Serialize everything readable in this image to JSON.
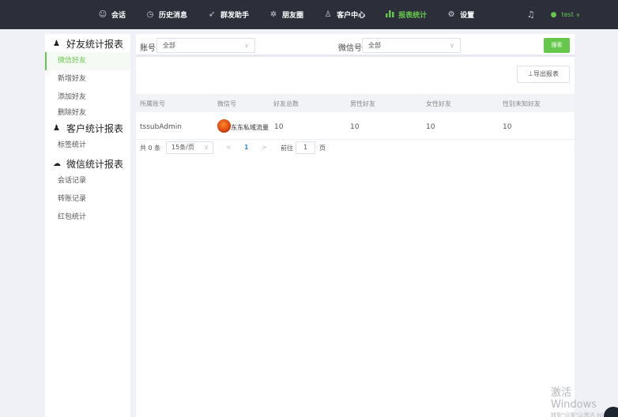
{
  "nav": {
    "items": [
      {
        "label": "会话",
        "icon": "chat-icon"
      },
      {
        "label": "历史消息",
        "icon": "clock-icon"
      },
      {
        "label": "群发助手",
        "icon": "send-icon"
      },
      {
        "label": "朋友圈",
        "icon": "aperture-icon"
      },
      {
        "label": "客户中心",
        "icon": "person-icon"
      },
      {
        "label": "报表统计",
        "icon": "bar-chart-icon",
        "active": true
      },
      {
        "label": "设置",
        "icon": "gear-icon"
      }
    ],
    "user": "test"
  },
  "sidebar": {
    "groups": [
      {
        "title": "好友统计报表",
        "items": [
          "微信好友",
          "新增好友",
          "添加好友",
          "删除好友"
        ]
      },
      {
        "title": "客户统计报表",
        "items": [
          "标签统计"
        ]
      },
      {
        "title": "微信统计报表",
        "items": [
          "会话记录",
          "转账记录",
          "红包统计"
        ]
      }
    ],
    "active_item": "微信好友"
  },
  "filters": {
    "account_label": "账号",
    "account_value": "全部",
    "wechat_label": "微信号",
    "wechat_value": "全部",
    "search_label": "搜索"
  },
  "export_label": "⊥导出报表",
  "table": {
    "columns": [
      "所属账号",
      "微信号",
      "好友总数",
      "男性好友",
      "女性好友",
      "性别未知好友"
    ],
    "rows": [
      {
        "account": "tssubAdmin",
        "wechat": "东东私域流量",
        "total": "10",
        "male": "10",
        "female": "10",
        "unknown": "10"
      }
    ]
  },
  "pagination": {
    "total": "共 0 条",
    "page_size": "15条/页",
    "prev": "<",
    "current": "1",
    "next": ">",
    "goto_label": "前往",
    "goto_value": "1",
    "page_suffix": "页"
  },
  "watermark": {
    "line1": "激活 Windows",
    "line2": "转到\"设置\"以激活 Wi"
  },
  "colors": {
    "accent": "#66c84b",
    "topbar": "#2c2f3a",
    "link": "#3a8ee6"
  }
}
